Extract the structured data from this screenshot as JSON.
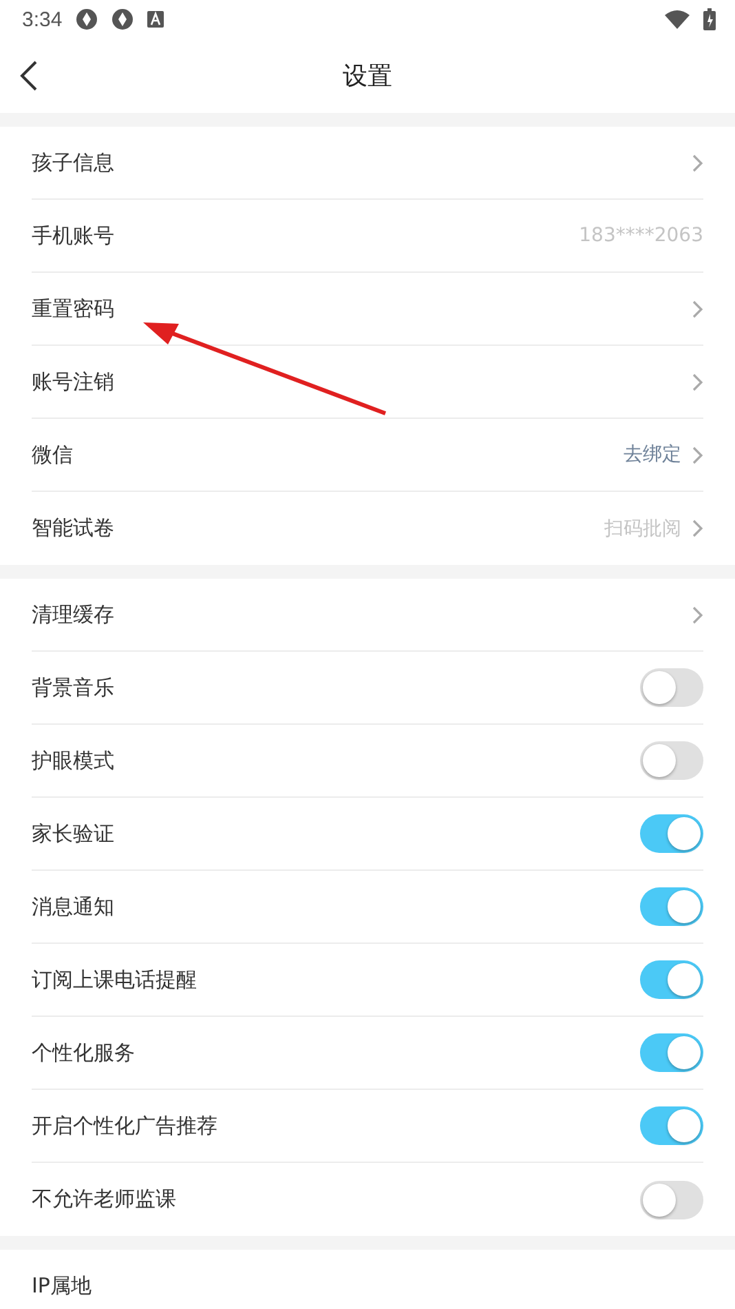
{
  "status_bar": {
    "time": "3:34"
  },
  "header": {
    "title": "设置"
  },
  "sections": [
    {
      "rows": [
        {
          "label": "孩子信息",
          "kind": "nav",
          "chevron": true
        },
        {
          "label": "手机账号",
          "kind": "nav",
          "value": "183****2063",
          "accent": false,
          "chevron": false
        },
        {
          "label": "重置密码",
          "kind": "nav",
          "chevron": true
        },
        {
          "label": "账号注销",
          "kind": "nav",
          "chevron": true
        },
        {
          "label": "微信",
          "kind": "nav",
          "value": "去绑定",
          "accent": true,
          "chevron": true
        },
        {
          "label": "智能试卷",
          "kind": "nav",
          "value": "扫码批阅",
          "accent": false,
          "chevron": true
        }
      ]
    },
    {
      "rows": [
        {
          "label": "清理缓存",
          "kind": "nav",
          "chevron": true
        },
        {
          "label": "背景音乐",
          "kind": "toggle",
          "on": false
        },
        {
          "label": "护眼模式",
          "kind": "toggle",
          "on": false
        },
        {
          "label": "家长验证",
          "kind": "toggle",
          "on": true
        },
        {
          "label": "消息通知",
          "kind": "toggle",
          "on": true
        },
        {
          "label": "订阅上课电话提醒",
          "kind": "toggle",
          "on": true
        },
        {
          "label": "个性化服务",
          "kind": "toggle",
          "on": true
        },
        {
          "label": "开启个性化广告推荐",
          "kind": "toggle",
          "on": true
        },
        {
          "label": "不允许老师监课",
          "kind": "toggle",
          "on": false
        }
      ]
    },
    {
      "rows": [
        {
          "label": "IP属地",
          "kind": "nav",
          "chevron": false
        }
      ]
    }
  ]
}
